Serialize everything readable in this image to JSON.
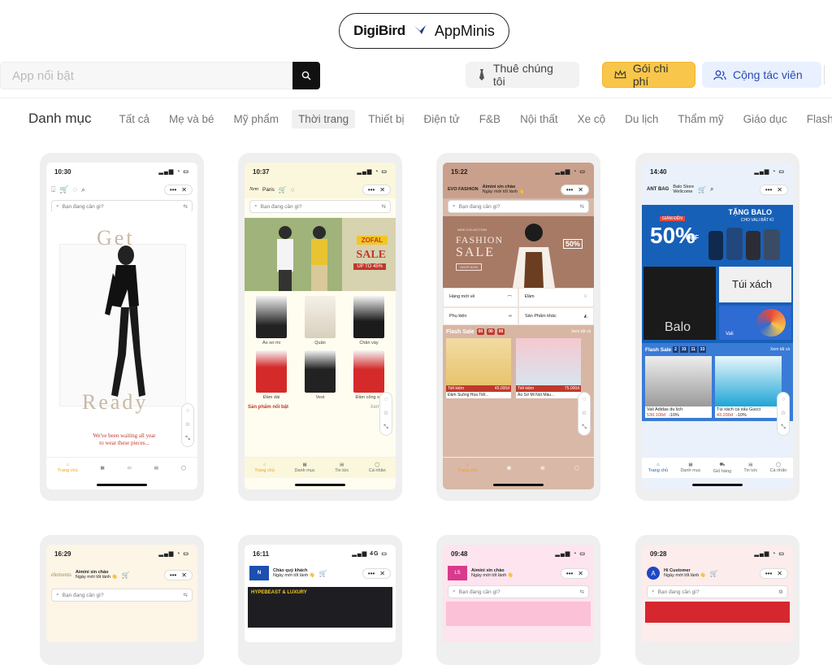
{
  "header": {
    "brand_a": "DigiBird",
    "brand_b": "AppMinis"
  },
  "search": {
    "placeholder": "App nổi bật"
  },
  "buttons": {
    "hire": "Thuê chúng tôi",
    "package": "Gói chi phí",
    "collaborator": "Cộng tác viên"
  },
  "categories": {
    "title": "Danh mục",
    "items": [
      "Tất cả",
      "Mẹ và bé",
      "Mỹ phẩm",
      "Thời trang",
      "Thiết bị",
      "Điện tử",
      "F&B",
      "Nội thất",
      "Xe cộ",
      "Du lịch",
      "Thẩm mỹ",
      "Giáo dục",
      "Flash s"
    ],
    "active": "Thời trang"
  },
  "colors": {
    "accent_yellow": "#f8c64a",
    "accent_blue": "#2a4bb7",
    "dark": "#111111"
  },
  "common": {
    "search_hint": "Bạn đang cần gì?"
  },
  "cards": [
    {
      "time": "10:30",
      "word_top": "Get",
      "word_bottom": "Ready",
      "tagline_1": "We've been waiting all year",
      "tagline_2": "to wear these pieces...",
      "tabs": [
        "Trang chủ"
      ]
    },
    {
      "time": "10:37",
      "brand": "Paris",
      "banner_brand": "ZOFAL",
      "banner_sale": "SALE",
      "banner_off": "UP TO 45%",
      "products": [
        "Áo sơ mi",
        "Quần",
        "Chân váy",
        "Đầm dài",
        "Vest",
        "Đầm công sở"
      ],
      "featured": "Sản phẩm nổi bật",
      "see_more": "Xem thêm",
      "tabs": [
        "Trang chủ",
        "Danh mục",
        "Tin tức",
        "Cá nhân"
      ]
    },
    {
      "time": "15:22",
      "brand": "EVO FASHION",
      "greeting": "Aimini xin chào",
      "greeting_sub": "Ngày mới tốt lành 👋",
      "banner_tag": "NEW COLLECTION",
      "banner_title_1": "FASHION",
      "banner_title_2": "SALE",
      "banner_pct": "50%",
      "banner_shop": "SHOP NOW",
      "cats": [
        "Hàng mới về",
        "Đầm",
        "Phụ kiện",
        "Sản Phẩm khác"
      ],
      "flash": "Flash Sale",
      "timer": [
        "00",
        "00",
        "00"
      ],
      "see_all": "Xem tất cả",
      "deals": [
        {
          "name": "Đầm Suông Họa Tiết...",
          "price": "45.000đ",
          "tag": "Tiết kiệm"
        },
        {
          "name": "Áo Sơ Mi Nút Màu...",
          "price": "75.000đ",
          "tag": "Tiết kiệm"
        }
      ],
      "tabs": [
        "Trang chủ"
      ]
    },
    {
      "time": "14:40",
      "brand": "ANT BAG",
      "store": "Balo Store",
      "welcome": "Wellcome",
      "promo_top": "TẶNG BALO",
      "promo_sub": "CHO VALI BẤT KÌ",
      "promo_pct": "50%",
      "promo_label": "GIẢM ĐẾN",
      "promo_off": "OFF",
      "tile_a": "Balo",
      "tile_b": "Túi xách",
      "tile_c": "Vali",
      "flash": "Flash Sale",
      "timer": [
        "2",
        "33",
        "11",
        "33"
      ],
      "see_all": "Xem tất cả",
      "deals": [
        {
          "name": "Vali Adidas du lịch",
          "price": "530.100đ",
          "disc": "-10%"
        },
        {
          "name": "Túi xách cá xấu Gucci",
          "price": "43.200đ",
          "disc": "-10%",
          "sub": "Túi xách"
        }
      ],
      "tabs": [
        "Trang chủ",
        "Danh mục",
        "Giỏ hàng",
        "Tin tức",
        "Cá nhân"
      ]
    },
    {
      "time": "16:29",
      "brand": "elements",
      "greeting": "Aimini xin chào",
      "greeting_sub": "Ngày mới tốt lành 👋"
    },
    {
      "time": "16:11",
      "greeting": "Chào quý khách",
      "greeting_sub": "Ngày mới tốt lành 👋",
      "banner": "HYPEBEAST & LUXURY",
      "network": "4G"
    },
    {
      "time": "09:48",
      "greeting": "Aimini xin chào",
      "greeting_sub": "Ngày mới tốt lành 👋"
    },
    {
      "time": "09:28",
      "greeting": "Hi Customer",
      "greeting_sub": "Ngày mới tốt lành 👋",
      "avatar": "A"
    }
  ]
}
